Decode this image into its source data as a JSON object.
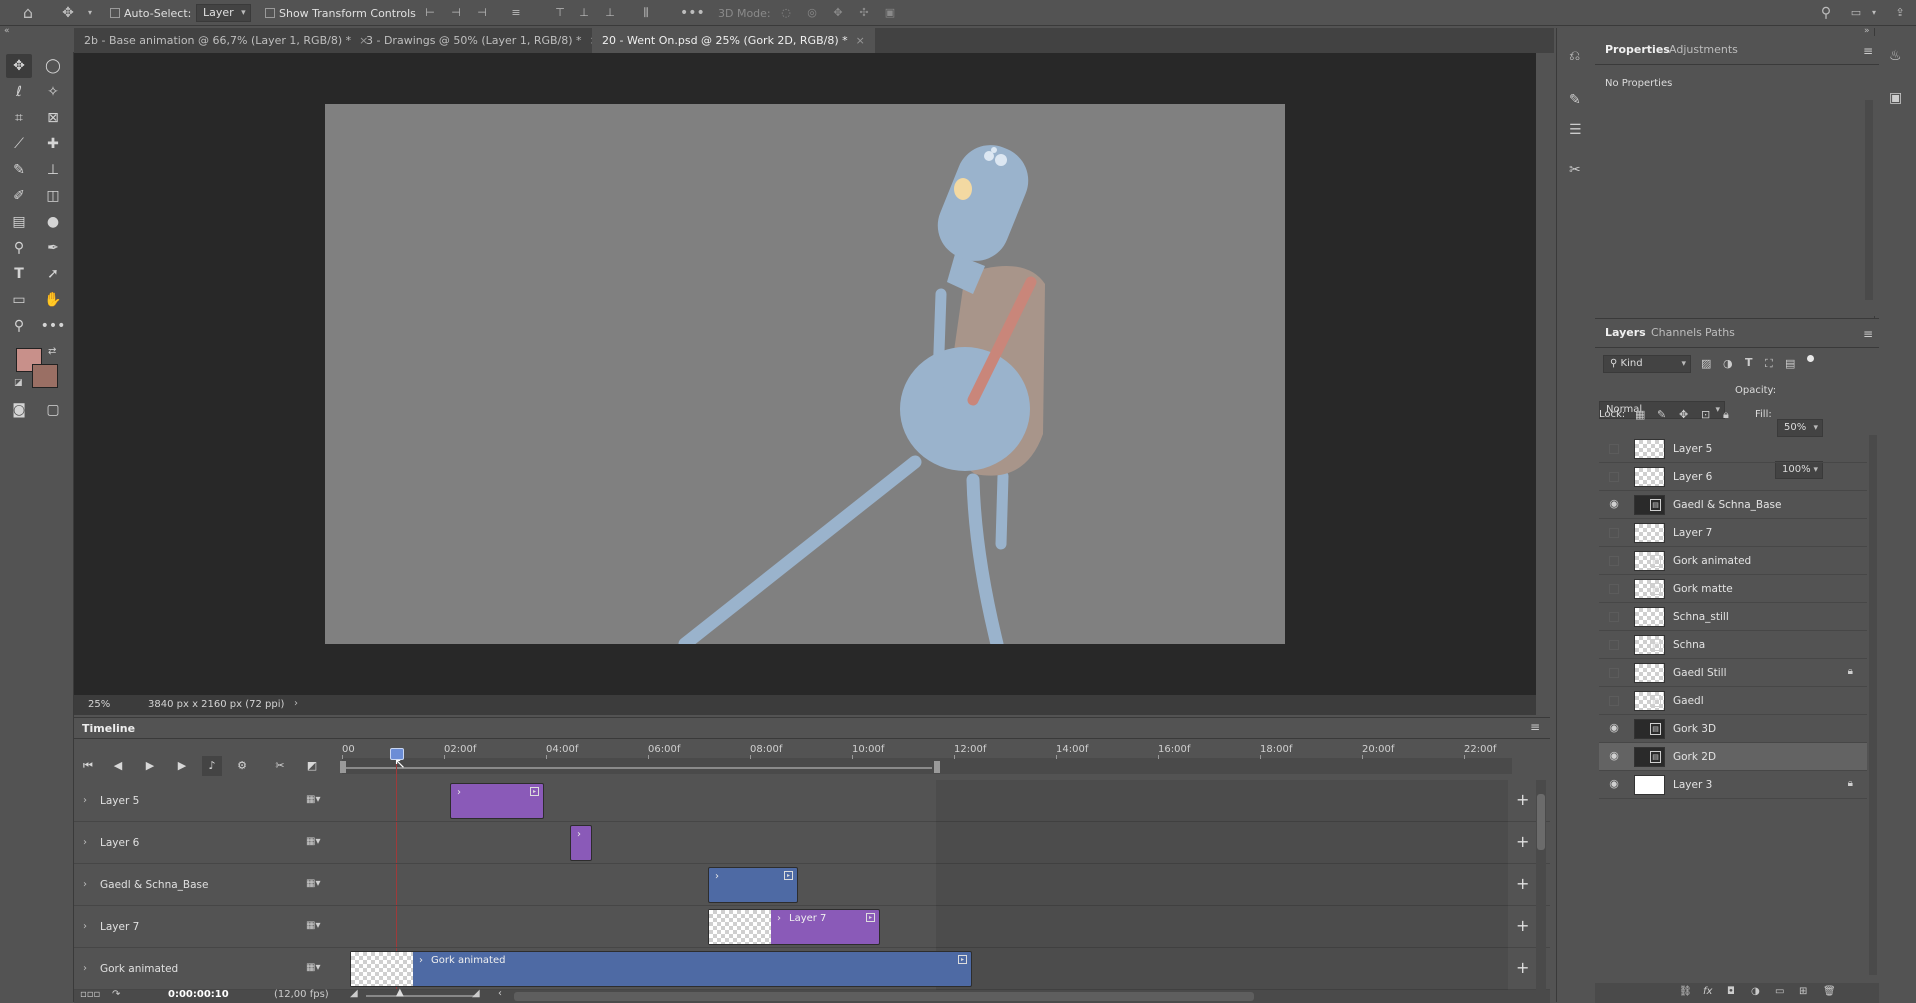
{
  "options_bar": {
    "auto_select_label": "Auto-Select:",
    "auto_select_value": "Layer",
    "show_transform_label": "Show Transform Controls",
    "three_d_mode_label": "3D Mode:"
  },
  "tabs": [
    {
      "label": "2b - Base animation @ 66,7% (Layer 1, RGB/8) *"
    },
    {
      "label": "3 - Drawings @ 50% (Layer 1, RGB/8) *"
    },
    {
      "label": "20 - Went On.psd @ 25% (Gork 2D, RGB/8) *"
    }
  ],
  "status": {
    "zoom": "25%",
    "doc_size": "3840 px x 2160 px (72 ppi)"
  },
  "colors": {
    "foreground": "#c8908a",
    "background": "#9a6f64",
    "canvas_bg": "#808080",
    "character": "#9ab3cc",
    "torso": "#a8958a",
    "strap": "#c9867a",
    "eye": "#f3d9a2"
  },
  "properties": {
    "tab_properties": "Properties",
    "tab_adjustments": "Adjustments",
    "empty_text": "No Properties"
  },
  "layers_panel": {
    "tab_layers": "Layers",
    "tab_channels": "Channels",
    "tab_paths": "Paths",
    "filter_kind": "Kind",
    "blend_mode": "Normal",
    "opacity_label": "Opacity:",
    "opacity_value": "50%",
    "lock_label": "Lock:",
    "fill_label": "Fill:",
    "fill_value": "100%",
    "layers": [
      {
        "name": "Layer 5",
        "visible": false,
        "thumb": "checker",
        "smart": false,
        "locked": false
      },
      {
        "name": "Layer 6",
        "visible": false,
        "thumb": "checker",
        "smart": false,
        "locked": false
      },
      {
        "name": "Gaedl & Schna_Base",
        "visible": true,
        "thumb": "dark",
        "smart": true,
        "locked": false
      },
      {
        "name": "Layer 7",
        "visible": false,
        "thumb": "checker",
        "smart": false,
        "locked": false
      },
      {
        "name": "Gork animated",
        "visible": false,
        "thumb": "checker",
        "smart": true,
        "locked": false
      },
      {
        "name": "Gork matte",
        "visible": false,
        "thumb": "checker",
        "smart": true,
        "locked": false
      },
      {
        "name": "Schna_still",
        "visible": false,
        "thumb": "checker",
        "smart": false,
        "locked": false
      },
      {
        "name": "Schna",
        "visible": false,
        "thumb": "checker",
        "smart": true,
        "locked": false
      },
      {
        "name": "Gaedl Still",
        "visible": false,
        "thumb": "checker",
        "smart": false,
        "locked": true
      },
      {
        "name": "Gaedl",
        "visible": false,
        "thumb": "checker",
        "smart": true,
        "locked": false
      },
      {
        "name": "Gork 3D",
        "visible": true,
        "thumb": "dark",
        "smart": true,
        "locked": false
      },
      {
        "name": "Gork 2D",
        "visible": true,
        "thumb": "dark",
        "smart": true,
        "locked": false,
        "selected": true
      },
      {
        "name": "Layer 3",
        "visible": true,
        "thumb": "white",
        "smart": false,
        "locked": true
      }
    ]
  },
  "timeline": {
    "title": "Timeline",
    "ruler": [
      "00",
      "02:00f",
      "04:00f",
      "06:00f",
      "08:00f",
      "10:00f",
      "12:00f",
      "14:00f",
      "16:00f",
      "18:00f",
      "20:00f",
      "22:00f"
    ],
    "current_time": "0:00:00:10",
    "fps": "(12,00 fps)",
    "tracks": [
      {
        "name": "Layer 5"
      },
      {
        "name": "Layer 6"
      },
      {
        "name": "Gaedl & Schna_Base"
      },
      {
        "name": "Layer 7",
        "clip_label": "Layer 7"
      },
      {
        "name": "Gork animated",
        "clip_label": "Gork animated"
      }
    ]
  }
}
